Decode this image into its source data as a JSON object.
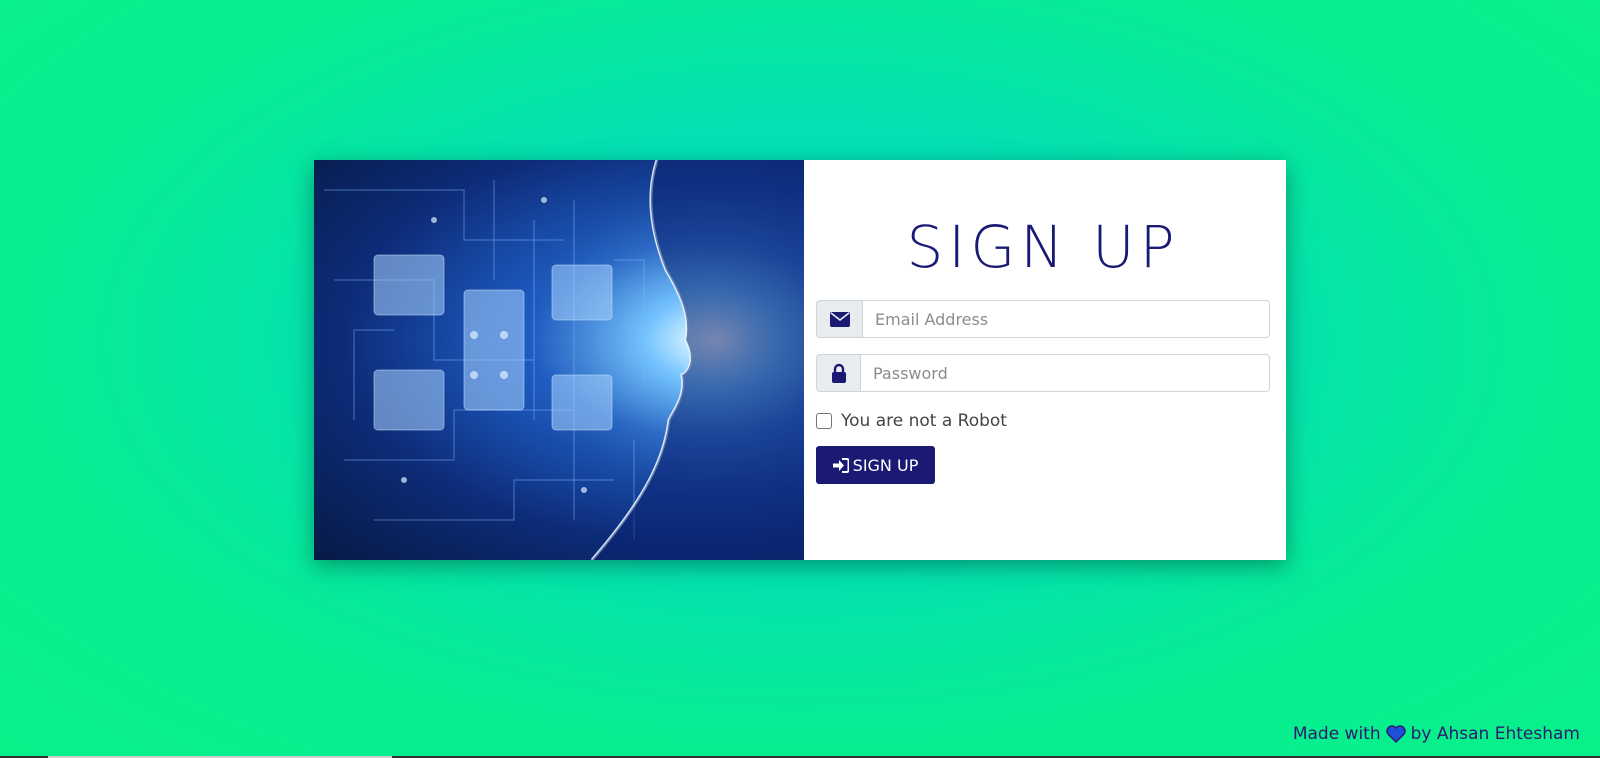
{
  "title": "SIGN UP",
  "email": {
    "placeholder": "Email Address",
    "icon": "envelope-icon"
  },
  "password": {
    "placeholder": "Password",
    "icon": "lock-icon"
  },
  "robot_check": {
    "label": "You are not a Robot",
    "checked": false
  },
  "submit": {
    "label": "SIGN UP",
    "icon": "sign-in-icon"
  },
  "credit": {
    "prefix": "Made with",
    "suffix": "by Ahsan Ehtesham",
    "icon": "heart-icon"
  },
  "colors": {
    "accent": "#1a1a75",
    "background_start": "#07ee90",
    "background_end": "#00d8c8",
    "heart": "#1d4fd8"
  }
}
